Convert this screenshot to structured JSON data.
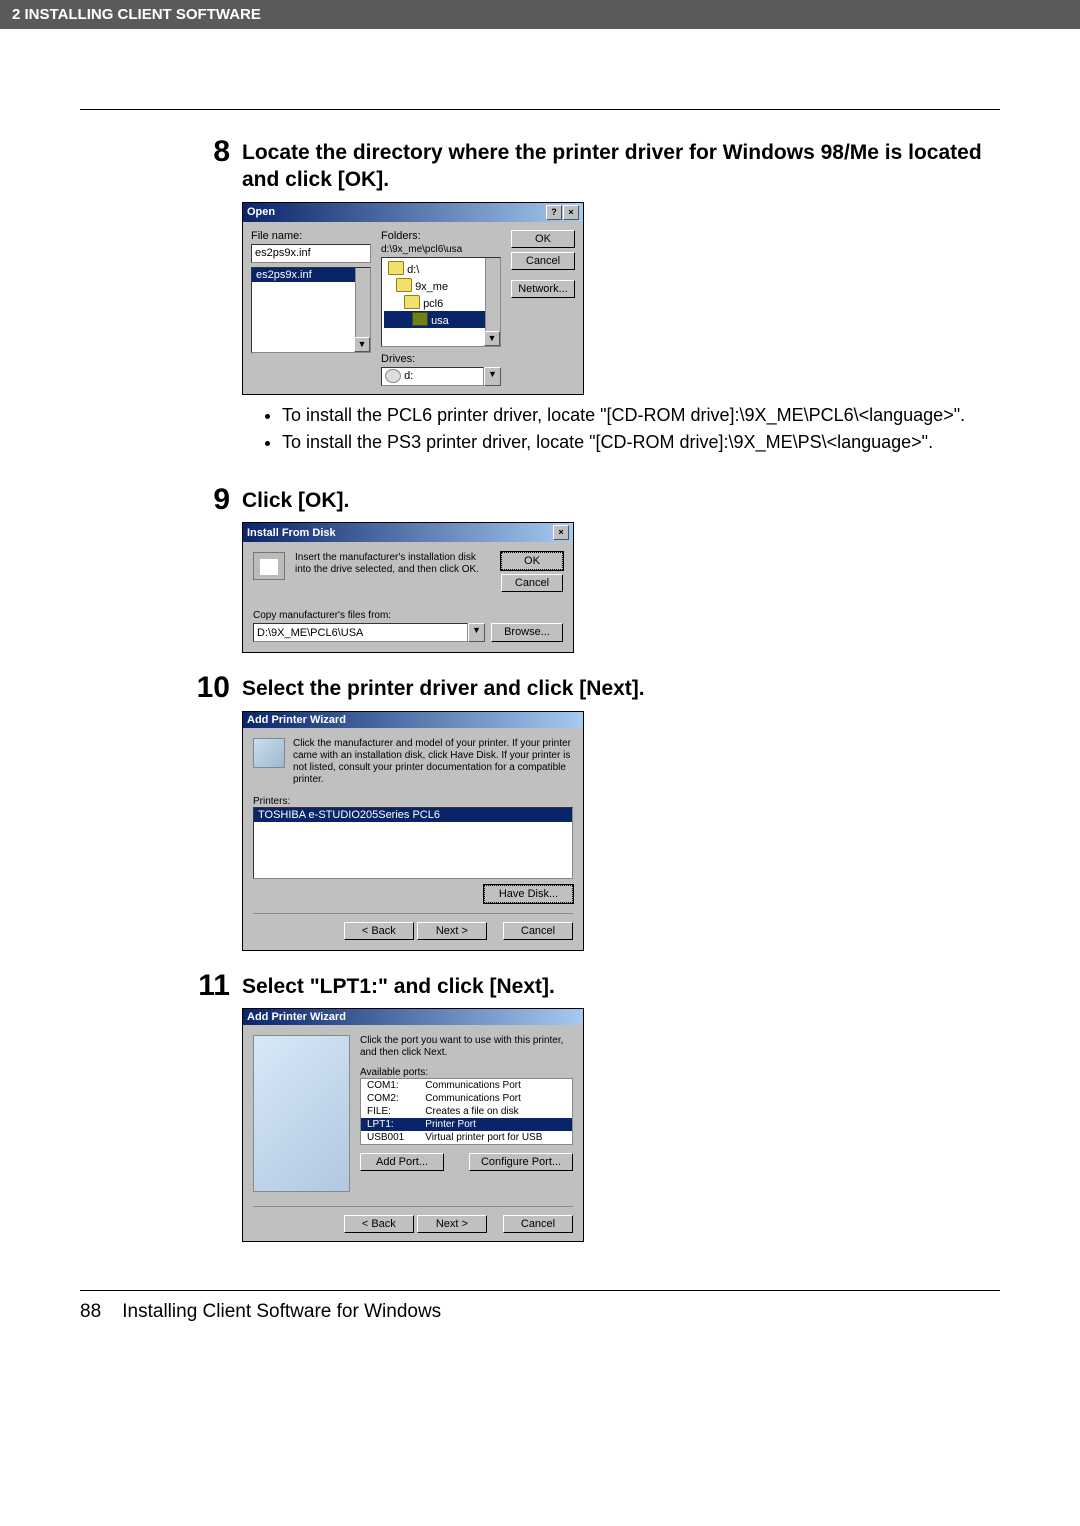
{
  "header": {
    "section_title": "2   INSTALLING CLIENT SOFTWARE"
  },
  "footer": {
    "page_num": "88",
    "text": "Installing Client Software for Windows"
  },
  "step8": {
    "num": "8",
    "heading": "Locate the directory where the printer driver for Windows 98/Me is located and click [OK].",
    "bullets": [
      "To install the PCL6 printer driver, locate \"[CD-ROM drive]:\\9X_ME\\PCL6\\<language>\".",
      "To install the PS3 printer driver, locate \"[CD-ROM drive]:\\9X_ME\\PS\\<language>\"."
    ],
    "dialog": {
      "title": "Open",
      "filename_label": "File name:",
      "filename_value": "es2ps9x.inf",
      "file_listbox_item": "es2ps9x.inf",
      "folders_label": "Folders:",
      "folders_path": "d:\\9x_me\\pcl6\\usa",
      "folder_items": [
        "d:\\",
        "9x_me",
        "pcl6",
        "usa"
      ],
      "drives_label": "Drives:",
      "drive_value": "d:",
      "ok": "OK",
      "cancel": "Cancel",
      "network": "Network..."
    }
  },
  "step9": {
    "num": "9",
    "heading": "Click [OK].",
    "dialog": {
      "title": "Install From Disk",
      "text": "Insert the manufacturer's installation disk into the drive selected, and then click OK.",
      "copy_label": "Copy manufacturer's files from:",
      "path": "D:\\9X_ME\\PCL6\\USA",
      "ok": "OK",
      "cancel": "Cancel",
      "browse": "Browse..."
    }
  },
  "step10": {
    "num": "10",
    "heading": "Select the printer driver and click [Next].",
    "dialog": {
      "title": "Add Printer Wizard",
      "text": "Click the manufacturer and model of your printer. If your printer came with an installation disk, click Have Disk. If your printer is not listed, consult your printer documentation for a compatible printer.",
      "printers_label": "Printers:",
      "printer_item": "TOSHIBA e-STUDIO205Series PCL6",
      "have_disk": "Have Disk...",
      "back": "< Back",
      "next": "Next >",
      "cancel": "Cancel"
    }
  },
  "step11": {
    "num": "11",
    "heading": "Select \"LPT1:\" and click [Next].",
    "dialog": {
      "title": "Add Printer Wizard",
      "text": "Click the port you want to use with this printer, and then click Next.",
      "ports_label": "Available ports:",
      "ports": [
        {
          "code": "COM1:",
          "desc": "Communications Port"
        },
        {
          "code": "COM2:",
          "desc": "Communications Port"
        },
        {
          "code": "FILE:",
          "desc": "Creates a file on disk"
        },
        {
          "code": "LPT1:",
          "desc": "Printer Port"
        },
        {
          "code": "USB001",
          "desc": "Virtual printer port for USB"
        }
      ],
      "add_port": "Add Port...",
      "configure_port": "Configure Port...",
      "back": "< Back",
      "next": "Next >",
      "cancel": "Cancel"
    }
  }
}
